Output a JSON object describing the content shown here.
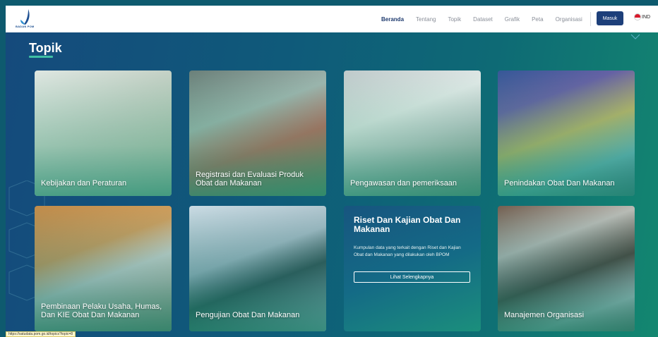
{
  "header": {
    "logo_text": "BADAN POM",
    "nav": [
      {
        "label": "Beranda",
        "active": true
      },
      {
        "label": "Tentang",
        "active": false
      },
      {
        "label": "Topik",
        "active": false
      },
      {
        "label": "Dataset",
        "active": false
      },
      {
        "label": "Grafik",
        "active": false
      },
      {
        "label": "Peta",
        "active": false
      },
      {
        "label": "Organisasi",
        "active": false
      }
    ],
    "login_label": "Masuk",
    "language_label": "IND"
  },
  "main": {
    "title": "Topik",
    "cards": [
      {
        "label": "Kebijakan dan Peraturan"
      },
      {
        "label": "Registrasi dan Evaluasi Produk Obat dan Makanan"
      },
      {
        "label": "Pengawasan dan pemeriksaan"
      },
      {
        "label": "Penindakan Obat Dan Makanan"
      },
      {
        "label": "Pembinaan Pelaku Usaha, Humas, Dan KIE Obat Dan Makanan"
      },
      {
        "label": "Pengujian Obat Dan Makanan"
      },
      {
        "label": "Manajemen Organisasi"
      }
    ],
    "riset_card": {
      "title": "Riset Dan Kajian Obat Dan Makanan",
      "description": "Kumpulan data yang terkait dengan Riset dan Kajian Obat dan Makanan yang dilakukan oleh BPOM",
      "button_label": "Lihat Selengkapnya"
    }
  },
  "status_bar": {
    "url": "https://satudata.pom.go.id/topics?topic=8"
  },
  "colors": {
    "nav_active": "#1f3b6f",
    "login_button": "#1d3f7a",
    "accent_underline": "#3fbfa4",
    "background_start": "#154a7c",
    "background_end": "#138770"
  }
}
